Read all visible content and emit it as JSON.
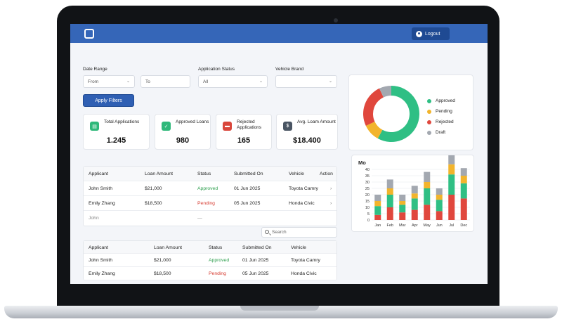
{
  "header": {
    "logout_label": "Logout"
  },
  "filters": {
    "date_range_label": "Date Range",
    "from_placeholder": "From",
    "to_placeholder": "To",
    "status_label": "Application Status",
    "status_value": "All",
    "brand_label": "Vehicle Brand",
    "brand_value": "",
    "apply_label": "Apply Filters"
  },
  "stats": [
    {
      "title": "Total Applications",
      "value": "1.245",
      "icon": "document-icon",
      "color": "#2fb87a"
    },
    {
      "title": "Approved Loans",
      "value": "980",
      "icon": "check-icon",
      "color": "#2fb87a"
    },
    {
      "title": "Rejected Applications",
      "value": "165",
      "icon": "rejected-icon",
      "color": "#d9463b"
    },
    {
      "title": "Avg. Loam Amount",
      "value": "$18.400",
      "icon": "dollar-icon",
      "color": "#4a5563"
    }
  ],
  "table1": {
    "headers": [
      "Applicant",
      "Loan Amount",
      "Status",
      "Submitted On",
      "Vehicle",
      "Action"
    ],
    "rows": [
      {
        "applicant": "John Smith",
        "amount": "$21,000",
        "status": "Approved",
        "submitted": "01 Jun 2025",
        "vehicle": "Toyota Camry"
      },
      {
        "applicant": "Emily Zhang",
        "amount": "$18,500",
        "status": "Pending",
        "submitted": "05 Jun 2025",
        "vehicle": "Honda Civic"
      }
    ],
    "partial_row": {
      "applicant": "John",
      "amount": "—"
    }
  },
  "search": {
    "placeholder": "Search"
  },
  "table2": {
    "headers": [
      "Applicant",
      "Loan Amount",
      "Status",
      "Submitted On",
      "Vehicle"
    ],
    "rows": [
      {
        "applicant": "John Smith",
        "amount": "$21,000",
        "status": "Approved",
        "submitted": "01 Jun 2025",
        "vehicle": "Toyota Camry"
      },
      {
        "applicant": "Emily Zhang",
        "amount": "$18,500",
        "status": "Pending",
        "submitted": "05 Jun 2025",
        "vehicle": "Honda Civic"
      }
    ]
  },
  "donut": {
    "legend": [
      "Approved",
      "Pending",
      "Rejected",
      "Draft"
    ]
  },
  "bar_title": "Mo",
  "colors": {
    "approved": "#2fbf84",
    "pending": "#f2b42c",
    "rejected": "#e0473d",
    "draft": "#a3a8b0"
  },
  "chart_data": [
    {
      "type": "pie",
      "categories": [
        "Approved",
        "Pending",
        "Rejected",
        "Draft"
      ],
      "values": [
        58,
        10,
        25,
        7
      ]
    },
    {
      "type": "bar",
      "title": "Mo",
      "categories": [
        "Jan",
        "Feb",
        "Mar",
        "Apr",
        "May",
        "Jun",
        "Jul",
        "Dec"
      ],
      "series": [
        {
          "name": "Rejected",
          "values": [
            4,
            10,
            6,
            8,
            12,
            7,
            20,
            17
          ]
        },
        {
          "name": "Approved",
          "values": [
            7,
            10,
            6,
            9,
            13,
            9,
            16,
            12
          ]
        },
        {
          "name": "Pending",
          "values": [
            4,
            5,
            3,
            4,
            5,
            4,
            8,
            6
          ]
        },
        {
          "name": "Draft",
          "values": [
            5,
            7,
            5,
            6,
            8,
            5,
            12,
            6
          ]
        }
      ],
      "yticks": [
        0,
        5,
        10,
        15,
        20,
        25,
        30,
        35,
        40
      ],
      "ylim": [
        0,
        40
      ]
    }
  ]
}
